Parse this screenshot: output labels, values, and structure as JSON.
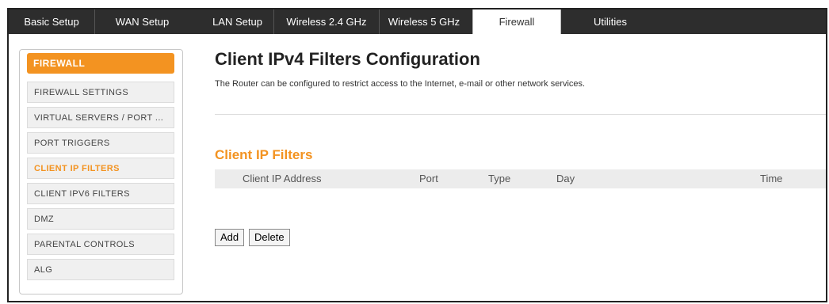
{
  "tabs": [
    {
      "label": "Basic Setup",
      "active": false
    },
    {
      "label": "WAN Setup",
      "active": false
    },
    {
      "label": "LAN Setup",
      "active": false
    },
    {
      "label": "Wireless 2.4 GHz",
      "active": false
    },
    {
      "label": "Wireless 5 GHz",
      "active": false
    },
    {
      "label": "Firewall",
      "active": true
    },
    {
      "label": "Utilities",
      "active": false
    }
  ],
  "sidebar": {
    "header": "FIREWALL",
    "items": [
      {
        "label": "FIREWALL SETTINGS",
        "active": false
      },
      {
        "label": "VIRTUAL SERVERS / PORT ...",
        "active": false
      },
      {
        "label": "PORT TRIGGERS",
        "active": false
      },
      {
        "label": "CLIENT IP FILTERS",
        "active": true
      },
      {
        "label": "CLIENT IPV6 FILTERS",
        "active": false
      },
      {
        "label": "DMZ",
        "active": false
      },
      {
        "label": "PARENTAL CONTROLS",
        "active": false
      },
      {
        "label": "ALG",
        "active": false
      }
    ]
  },
  "main": {
    "title": "Client IPv4 Filters Configuration",
    "description": "The Router can be configured to restrict access to the Internet, e-mail or other network services.",
    "section_title": "Client IP Filters",
    "table": {
      "columns": [
        "Client IP Address",
        "Port",
        "Type",
        "Day",
        "Time"
      ],
      "rows": []
    },
    "add_label": "Add",
    "delete_label": "Delete"
  },
  "colors": {
    "accent": "#f39321",
    "tabbar": "#2d2d2d"
  }
}
